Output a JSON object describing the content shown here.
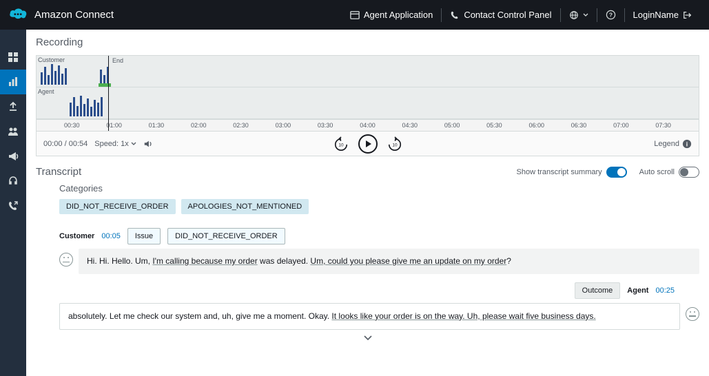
{
  "header": {
    "brand": "Amazon Connect",
    "agent_app": "Agent Application",
    "ccp": "Contact Control Panel",
    "login": "LoginName"
  },
  "recording": {
    "title": "Recording",
    "customer_label": "Customer",
    "agent_label": "Agent",
    "end_label": "End",
    "timeline": [
      "00:30",
      "01:00",
      "01:30",
      "02:00",
      "02:30",
      "03:00",
      "03:30",
      "04:00",
      "04:30",
      "05:00",
      "05:30",
      "06:00",
      "06:30",
      "07:00",
      "07:30"
    ],
    "time_current": "00:00",
    "time_total": "00:54",
    "speed_label": "Speed:",
    "speed_value": "1x",
    "legend_label": "Legend"
  },
  "transcript": {
    "title": "Transcript",
    "summary_toggle_label": "Show transcript summary",
    "autoscroll_label": "Auto scroll",
    "categories_title": "Categories",
    "categories": [
      "DID_NOT_RECEIVE_ORDER",
      "APOLOGIES_NOT_MENTIONED"
    ],
    "msg1": {
      "speaker": "Customer",
      "ts": "00:05",
      "issue_chip": "Issue",
      "cat_chip": "DID_NOT_RECEIVE_ORDER",
      "pre": "Hi. Hi. Hello. Um, ",
      "u1": "I'm calling because my order",
      "mid": " was delayed. ",
      "u2": "Um, could you please give me an update on my order",
      "post": "?"
    },
    "msg2": {
      "outcome_chip": "Outcome",
      "speaker": "Agent",
      "ts": "00:25",
      "pre": "absolutely. Let me check our system and, uh, give me a moment. Okay. ",
      "u1": "It looks like your order is on the way. Uh, please wait five business days."
    }
  }
}
